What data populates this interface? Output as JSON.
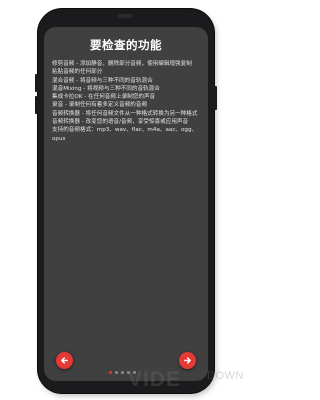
{
  "screen": {
    "title": "要检查的功能",
    "features": [
      "修剪音频 - 添加静音，删除部分音频，使用编辑增强复制",
      "粘贴音频的任何部分",
      "混合音频 - 将音频与三种不同的音轨混合",
      "混音Mixing - 将视频与三种不同的音轨混合",
      "集成卡拉OK - 在任何音频上录制您的声音",
      "录音 - 录制任何有着多定义音频的音频",
      "音频转换器 - 将任何音频文件从一种格式转换为另一种格式",
      "音频转换器 - 改变您的语音/音频，享受惊喜或应用声音",
      "支持的音频格式：mp3、wav、flac、m4a、aac、ogg、",
      "opus"
    ],
    "accent_color": "#e53935",
    "prev_icon": "arrow-left-icon",
    "next_icon": "arrow-right-icon",
    "page_indicator": {
      "total": 5,
      "active_index": 0
    }
  },
  "watermark": {
    "main": "VIDE",
    "sub": "DOWN"
  }
}
